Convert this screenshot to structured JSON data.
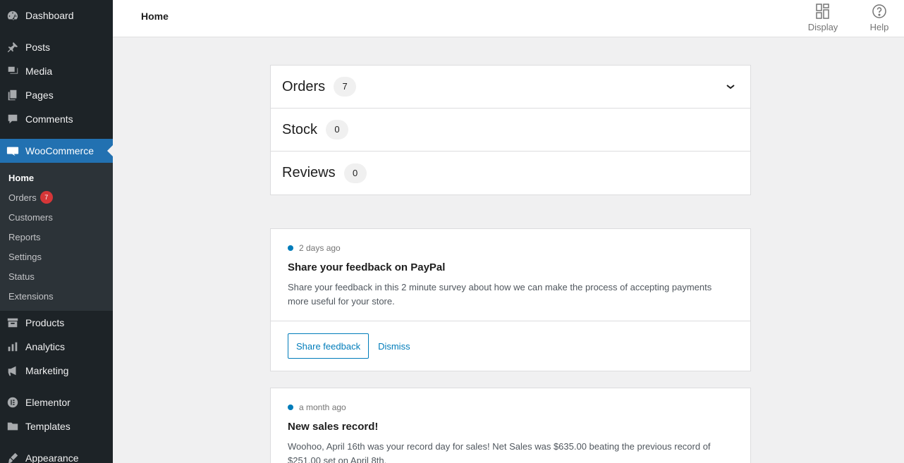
{
  "sidebar": {
    "top_items": [
      {
        "label": "Dashboard",
        "icon": "dashboard-icon"
      },
      {
        "label": "Posts",
        "icon": "pin-icon"
      },
      {
        "label": "Media",
        "icon": "media-icon"
      },
      {
        "label": "Pages",
        "icon": "pages-icon"
      },
      {
        "label": "Comments",
        "icon": "comment-icon"
      }
    ],
    "active": {
      "label": "WooCommerce",
      "icon": "woo-icon"
    },
    "submenu": [
      {
        "label": "Home"
      },
      {
        "label": "Orders",
        "badge": "7"
      },
      {
        "label": "Customers"
      },
      {
        "label": "Reports"
      },
      {
        "label": "Settings"
      },
      {
        "label": "Status"
      },
      {
        "label": "Extensions"
      }
    ],
    "bottom_items": [
      {
        "label": "Products",
        "icon": "archive-icon"
      },
      {
        "label": "Analytics",
        "icon": "bar-chart-icon"
      },
      {
        "label": "Marketing",
        "icon": "megaphone-icon"
      }
    ],
    "bottom_items2": [
      {
        "label": "Elementor",
        "icon": "elementor-icon"
      },
      {
        "label": "Templates",
        "icon": "folder-icon"
      }
    ],
    "bottom_items3": [
      {
        "label": "Appearance",
        "icon": "brush-icon"
      }
    ]
  },
  "header": {
    "title": "Home",
    "display_label": "Display",
    "help_label": "Help"
  },
  "stats": [
    {
      "label": "Orders",
      "count": "7"
    },
    {
      "label": "Stock",
      "count": "0"
    },
    {
      "label": "Reviews",
      "count": "0"
    }
  ],
  "notes": [
    {
      "time": "2 days ago",
      "title": "Share your feedback on PayPal",
      "text": "Share your feedback in this 2 minute survey about how we can make the process of accepting payments more useful for your store.",
      "primary_action": "Share feedback",
      "secondary_action": "Dismiss"
    },
    {
      "time": "a month ago",
      "title": "New sales record!",
      "text": "Woohoo, April 16th was your record day for sales! Net Sales was $635.00 beating the previous record of $251.00 set on April 8th."
    }
  ],
  "colors": {
    "sidebar_bg": "#1d2327",
    "active_bg": "#2271b1",
    "accent": "#007cba",
    "badge": "#d63638"
  }
}
